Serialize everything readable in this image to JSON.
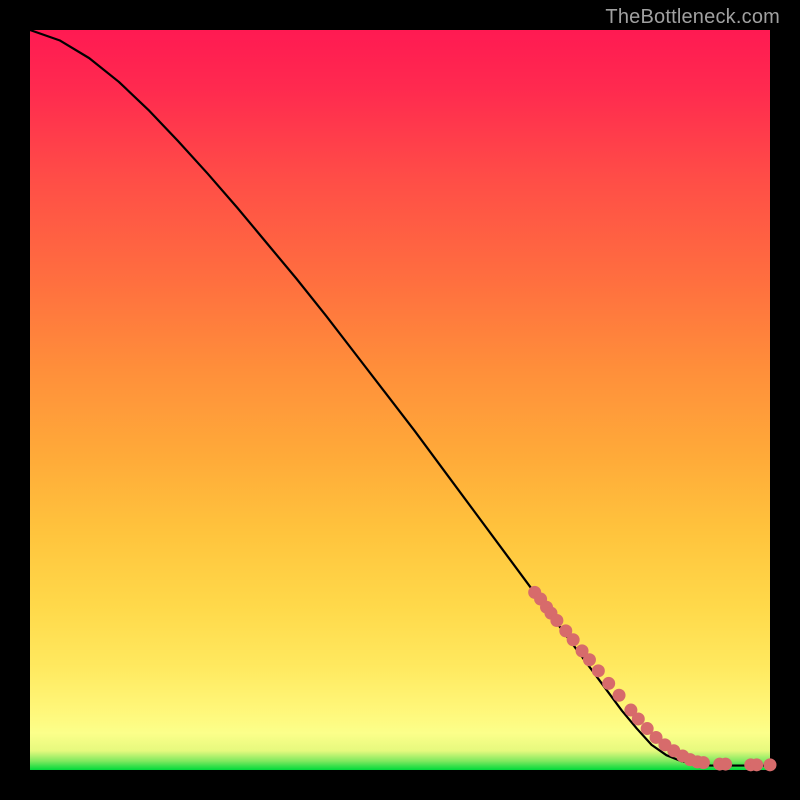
{
  "watermark": "TheBottleneck.com",
  "colors": {
    "curve": "#000000",
    "dot_fill": "#d76b6b",
    "dot_stroke": "#b84f4f",
    "background": "#000000"
  },
  "chart_data": {
    "type": "line",
    "title": "",
    "xlabel": "",
    "ylabel": "",
    "xlim": [
      0,
      100
    ],
    "ylim": [
      0,
      100
    ],
    "grid": false,
    "legend": false,
    "series": [
      {
        "name": "curve",
        "x": [
          0,
          4,
          8,
          12,
          16,
          20,
          24,
          28,
          32,
          36,
          40,
          44,
          48,
          52,
          56,
          60,
          64,
          68,
          72,
          76,
          80,
          82,
          84,
          86,
          88,
          90,
          92,
          94,
          96,
          98,
          100
        ],
        "y": [
          100,
          98.6,
          96.2,
          93.0,
          89.2,
          85.0,
          80.6,
          76.0,
          71.2,
          66.4,
          61.4,
          56.2,
          51.0,
          45.8,
          40.4,
          35.0,
          29.6,
          24.2,
          18.8,
          13.4,
          8.0,
          5.6,
          3.4,
          2.0,
          1.2,
          0.8,
          0.6,
          0.6,
          0.6,
          0.6,
          0.6
        ]
      }
    ],
    "dots": {
      "name": "markers",
      "x": [
        68.2,
        69.0,
        69.8,
        70.4,
        71.2,
        72.4,
        73.4,
        74.6,
        75.6,
        76.8,
        78.2,
        79.6,
        81.2,
        82.2,
        83.4,
        84.6,
        85.8,
        87.0,
        88.2,
        89.2,
        90.2,
        91.0,
        93.2,
        94.0,
        97.4,
        98.2,
        100.0
      ],
      "y": [
        24.0,
        23.1,
        22.0,
        21.2,
        20.2,
        18.8,
        17.6,
        16.1,
        14.9,
        13.4,
        11.7,
        10.1,
        8.1,
        6.9,
        5.6,
        4.4,
        3.4,
        2.6,
        1.9,
        1.4,
        1.1,
        1.0,
        0.8,
        0.8,
        0.7,
        0.7,
        0.7
      ]
    }
  }
}
